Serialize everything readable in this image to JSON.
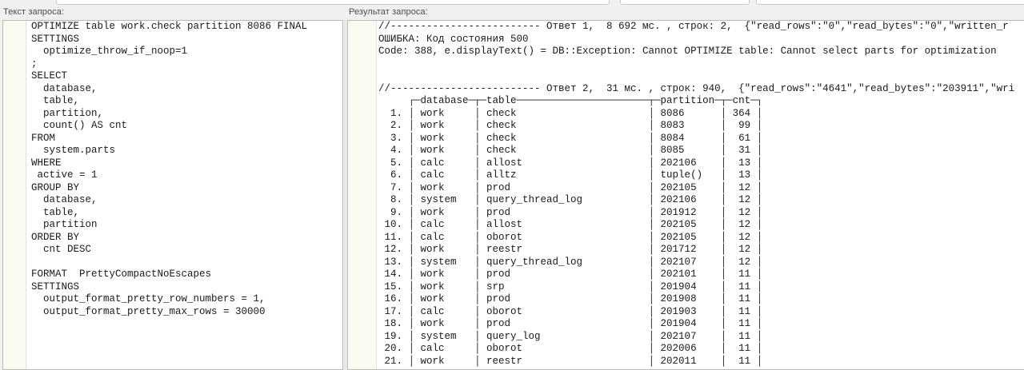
{
  "left_pane": {
    "label": "Текст запроса:",
    "lines": [
      "OPTIMIZE table work.check partition 8086 FINAL",
      "SETTINGS",
      "  optimize_throw_if_noop=1",
      ";",
      "SELECT",
      "  database,",
      "  table,",
      "  partition,",
      "  count() AS cnt",
      "FROM",
      "  system.parts",
      "WHERE",
      " active = 1",
      "GROUP BY",
      "  database,",
      "  table,",
      "  partition",
      "ORDER BY",
      "  cnt DESC",
      "",
      "FORMAT  PrettyCompactNoEscapes",
      "SETTINGS",
      "  output_format_pretty_row_numbers = 1,",
      "  output_format_pretty_max_rows = 30000"
    ]
  },
  "right_pane": {
    "label": "Результат запроса:",
    "lines": [
      "//------------------------- Ответ 1,  8 692 мс. , строк: 2,  {\"read_rows\":\"0\",\"read_bytes\":\"0\",\"written_r",
      "ОШИБКА: Код состояния 500",
      "Code: 388, e.displayText() = DB::Exception: Cannot OPTIMIZE table: Cannot select parts for optimization",
      "",
      "",
      "//------------------------- Ответ 2,  31 мс. , строк: 940,  {\"read_rows\":\"4641\",\"read_bytes\":\"203911\",\"wri",
      "     ┌─database─┬─table──────────────────────┬─partition─┬─cnt─┐",
      "  1. │ work     │ check                      │ 8086      │ 364 │",
      "  2. │ work     │ check                      │ 8083      │  99 │",
      "  3. │ work     │ check                      │ 8084      │  61 │",
      "  4. │ work     │ check                      │ 8085      │  31 │",
      "  5. │ calc     │ allost                     │ 202106    │  13 │",
      "  6. │ calc     │ alltz                      │ tuple()   │  13 │",
      "  7. │ work     │ prod                       │ 202105    │  12 │",
      "  8. │ system   │ query_thread_log           │ 202106    │  12 │",
      "  9. │ work     │ prod                       │ 201912    │  12 │",
      " 10. │ calc     │ allost                     │ 202105    │  12 │",
      " 11. │ calc     │ oborot                     │ 202105    │  12 │",
      " 12. │ work     │ reestr                     │ 201712    │  12 │",
      " 13. │ system   │ query_thread_log           │ 202107    │  12 │",
      " 14. │ work     │ prod                       │ 202101    │  11 │",
      " 15. │ work     │ srp                        │ 201904    │  11 │",
      " 16. │ work     │ prod                       │ 201908    │  11 │",
      " 17. │ calc     │ oborot                     │ 201903    │  11 │",
      " 18. │ work     │ prod                       │ 201904    │  11 │",
      " 19. │ system   │ query_log                  │ 202107    │  11 │",
      " 20. │ calc     │ oborot                     │ 202006    │  11 │",
      " 21. │ work     │ reestr                     │ 202011    │  11 │"
    ]
  }
}
